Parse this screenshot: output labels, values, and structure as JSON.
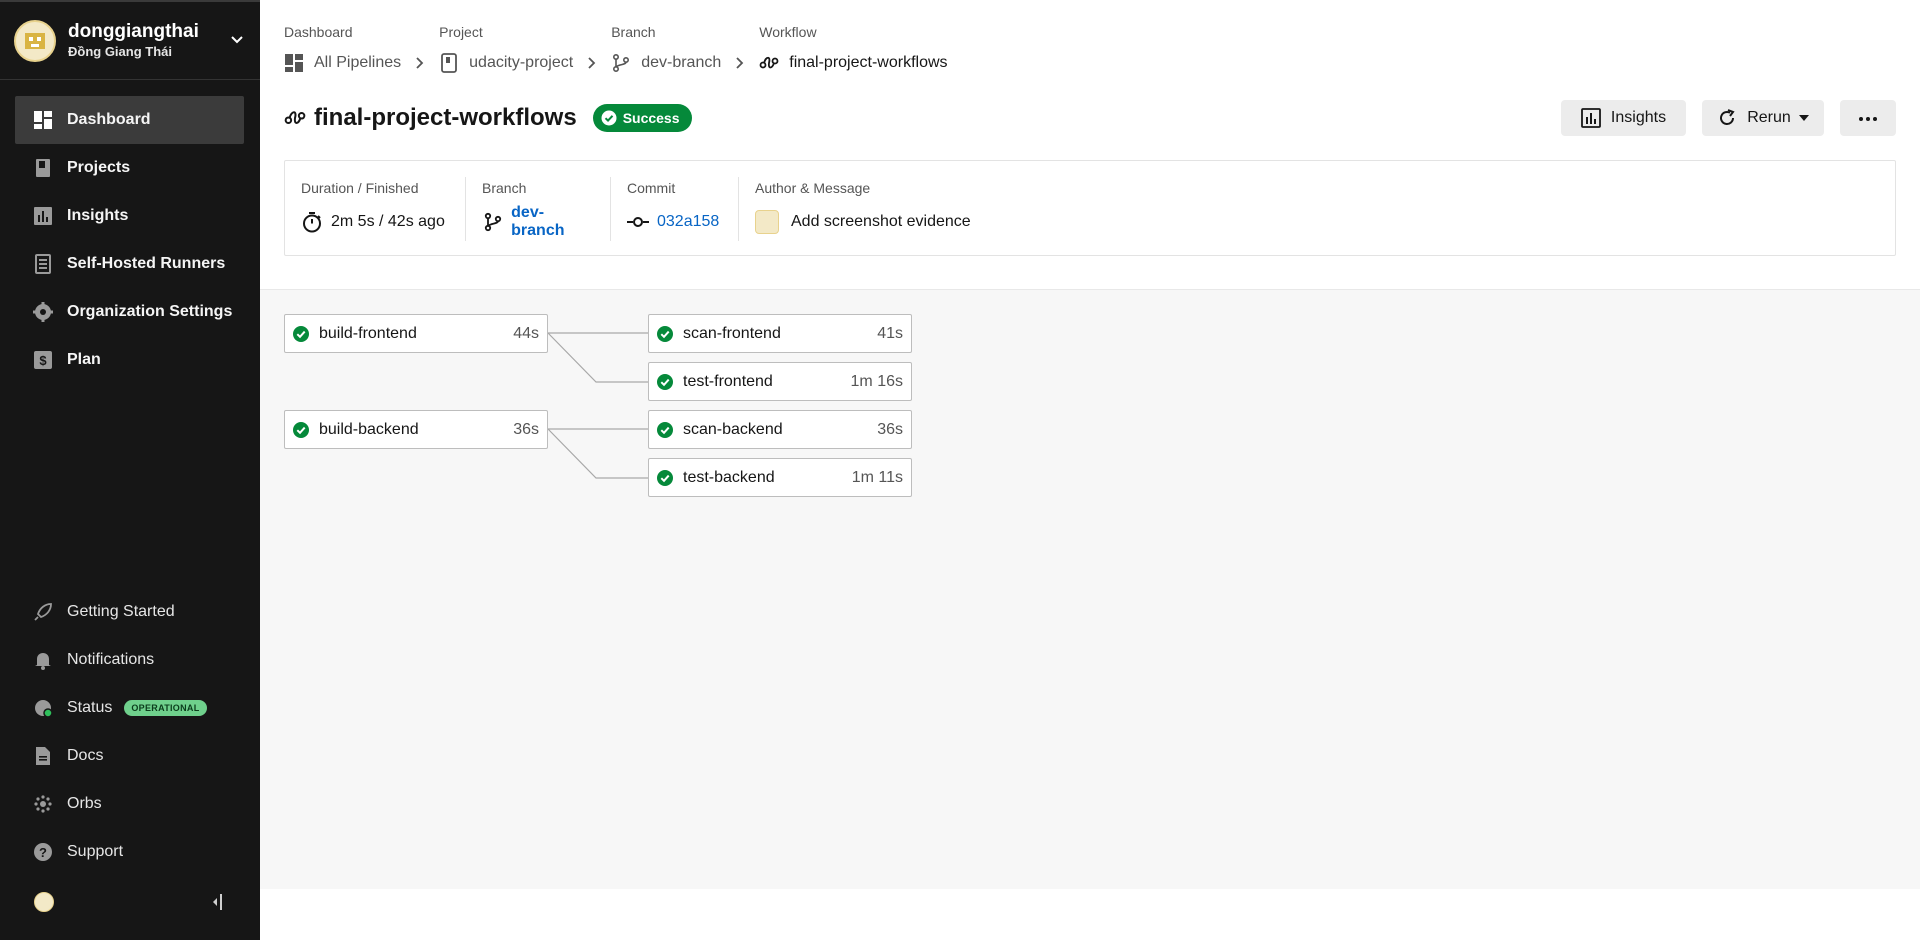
{
  "sidebar": {
    "org_name": "donggiangthai",
    "org_user": "Đồng Giang Thái",
    "nav": [
      {
        "label": "Dashboard",
        "icon": "dashboard-icon",
        "active": true
      },
      {
        "label": "Projects",
        "icon": "projects-icon"
      },
      {
        "label": "Insights",
        "icon": "insights-icon"
      },
      {
        "label": "Self-Hosted Runners",
        "icon": "runners-icon"
      },
      {
        "label": "Organization Settings",
        "icon": "gear-icon"
      },
      {
        "label": "Plan",
        "icon": "dollar-icon"
      }
    ],
    "bottom": [
      {
        "label": "Getting Started",
        "icon": "rocket-icon"
      },
      {
        "label": "Notifications",
        "icon": "bell-icon"
      },
      {
        "label": "Status",
        "icon": "status-icon",
        "badge": "OPERATIONAL"
      },
      {
        "label": "Docs",
        "icon": "docs-icon"
      },
      {
        "label": "Orbs",
        "icon": "orbs-icon"
      },
      {
        "label": "Support",
        "icon": "help-icon"
      }
    ]
  },
  "breadcrumbs": [
    {
      "label": "Dashboard",
      "value": "All Pipelines",
      "icon": "dashboard-icon"
    },
    {
      "label": "Project",
      "value": "udacity-project",
      "icon": "project-icon"
    },
    {
      "label": "Branch",
      "value": "dev-branch",
      "icon": "branch-icon"
    },
    {
      "label": "Workflow",
      "value": "final-project-workflows",
      "icon": "workflow-icon"
    }
  ],
  "header": {
    "title": "final-project-workflows",
    "status": "Success",
    "insights_label": "Insights",
    "rerun_label": "Rerun"
  },
  "summary": {
    "duration_label": "Duration / Finished",
    "duration_value": "2m 5s / 42s ago",
    "branch_label": "Branch",
    "branch_value": "dev-branch",
    "commit_label": "Commit",
    "commit_value": "032a158",
    "author_label": "Author & Message",
    "message": "Add screenshot evidence"
  },
  "jobs": [
    {
      "name": "build-frontend",
      "duration": "44s"
    },
    {
      "name": "scan-frontend",
      "duration": "41s"
    },
    {
      "name": "test-frontend",
      "duration": "1m 16s"
    },
    {
      "name": "build-backend",
      "duration": "36s"
    },
    {
      "name": "scan-backend",
      "duration": "36s"
    },
    {
      "name": "test-backend",
      "duration": "1m 11s"
    }
  ],
  "colors": {
    "success": "#05893a",
    "link": "#0865c5",
    "sidebar": "#161616"
  }
}
